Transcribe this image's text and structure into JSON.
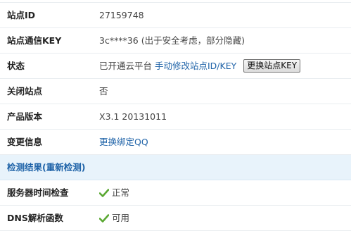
{
  "rows": [
    {
      "label": "站点ID",
      "value": "27159748"
    },
    {
      "label": "站点通信KEY",
      "value": "3c****36 (出于安全考虑，部分隐藏)"
    },
    {
      "label": "状态",
      "value_text": "已开通云平台",
      "link": "手动修改站点ID/KEY",
      "button": "更换站点KEY"
    },
    {
      "label": "关闭站点",
      "value": "否"
    },
    {
      "label": "产品版本",
      "value": "X3.1 20131011"
    },
    {
      "label": "变更信息",
      "link": "更换绑定QQ"
    }
  ],
  "section": {
    "title": "检测结果(重新检测)"
  },
  "checks": [
    {
      "label": "服务器时间检查",
      "status": "正常",
      "icon": "check-icon"
    },
    {
      "label": "DNS解析函数",
      "status": "可用",
      "icon": "check-icon"
    }
  ],
  "colors": {
    "link": "#1f63a8",
    "check": "#5aa832",
    "section_bg": "#e8f3fb"
  }
}
